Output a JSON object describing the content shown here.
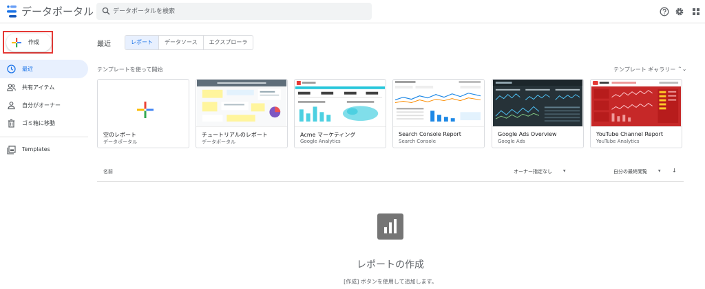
{
  "header": {
    "app_title": "データポータル",
    "search_placeholder": "データポータルを検索",
    "icons": [
      "help-icon",
      "gear-icon",
      "apps-grid-icon"
    ]
  },
  "sidebar": {
    "create_label": "作成",
    "items": [
      {
        "label": "最近",
        "icon": "clock-icon",
        "active": true
      },
      {
        "label": "共有アイテム",
        "icon": "people-icon",
        "active": false
      },
      {
        "label": "自分がオーナー",
        "icon": "person-icon",
        "active": false
      },
      {
        "label": "ゴミ箱に移動",
        "icon": "trash-icon",
        "active": false
      },
      {
        "label": "Templates",
        "icon": "templates-icon",
        "active": false
      }
    ]
  },
  "main": {
    "recent_title": "最近",
    "tabs": [
      {
        "label": "レポート",
        "active": true
      },
      {
        "label": "データソース",
        "active": false
      },
      {
        "label": "エクスプローラ",
        "active": false
      }
    ],
    "templates_start": "テンプレートを使って開始",
    "templates_gallery": "テンプレート ギャラリー",
    "templates_gallery_arrow": "⌃⌄",
    "templates": [
      {
        "title": "空のレポート",
        "subtitle": "データポータル"
      },
      {
        "title": "チュートリアルのレポート",
        "subtitle": "データポータル"
      },
      {
        "title": "Acme マーケティング",
        "subtitle": "Google Analytics"
      },
      {
        "title": "Search Console Report",
        "subtitle": "Search Console"
      },
      {
        "title": "Google Ads Overview",
        "subtitle": "Google Ads"
      },
      {
        "title": "YouTube Channel Report",
        "subtitle": "YouTube Analytics"
      }
    ],
    "list": {
      "col_name": "名前",
      "owner_filter": "オーナー指定なし",
      "sort_label": "自分の最終閲覧",
      "caret": "▾",
      "sort_arrow": "↓"
    },
    "empty": {
      "title": "レポートの作成",
      "subtitle": "[作成] ボタンを使用して追加します。"
    }
  },
  "colors": {
    "accent": "#1a73e8",
    "active_bg": "#e8f0fe",
    "highlight_border": "#e53935"
  }
}
